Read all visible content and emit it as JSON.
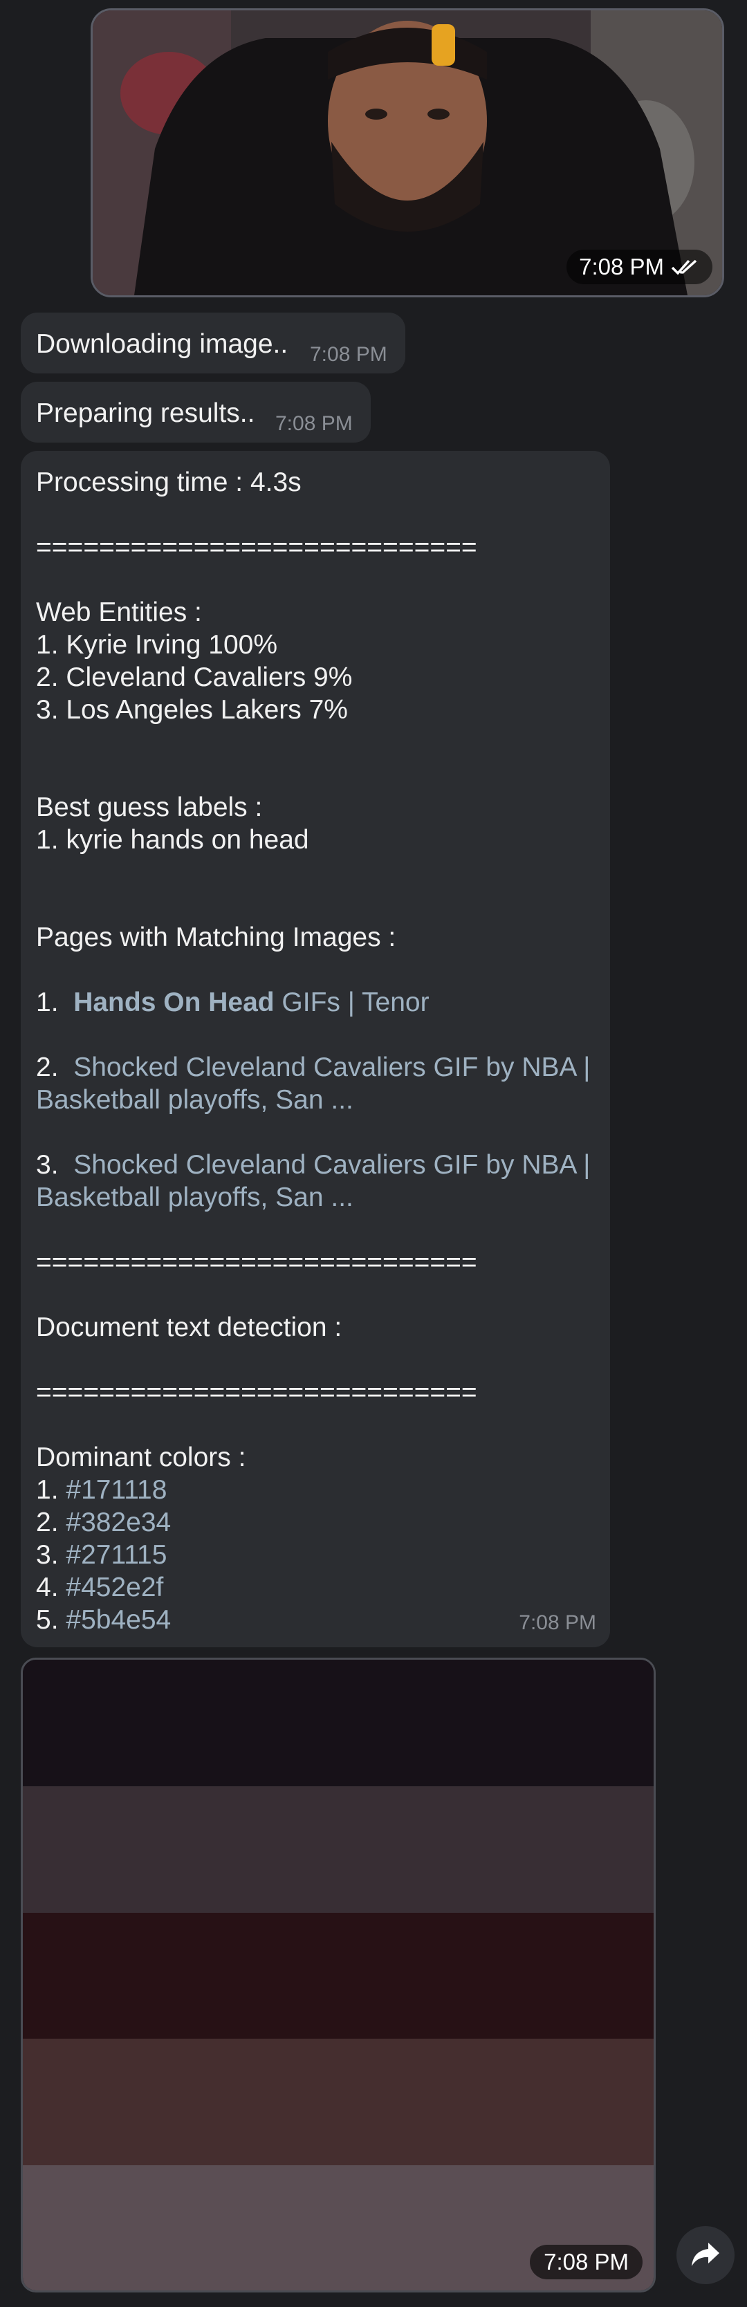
{
  "photo": {
    "time": "7:08 PM"
  },
  "status_messages": [
    {
      "text": "Downloading image..",
      "time": "7:08 PM"
    },
    {
      "text": "Preparing results..",
      "time": "7:08 PM"
    }
  ],
  "result": {
    "processing": "Processing time : 4.3s",
    "separator": "============================",
    "web_entities_title": "Web Entities :",
    "web_entities": [
      "1. Kyrie Irving 100%",
      "2. Cleveland Cavaliers 9%",
      "3. Los Angeles Lakers 7%"
    ],
    "best_guess_title": "Best guess labels :",
    "best_guess": [
      "1. kyrie hands on head"
    ],
    "pages_title": "Pages with Matching Images :",
    "pages": [
      {
        "num": "1.",
        "bold": "Hands On Head",
        "rest": " GIFs | Tenor"
      },
      {
        "num": "2.",
        "line1": "Shocked Cleveland Cavaliers GIF by NBA |",
        "line2": "Basketball playoffs, San ..."
      },
      {
        "num": "3.",
        "line1": "Shocked Cleveland Cavaliers GIF by NBA |",
        "line2": "Basketball playoffs, San ..."
      }
    ],
    "doc_text_title": "Document text detection :",
    "colors_title": "Dominant colors :",
    "colors": [
      {
        "num": "1.",
        "hex": "#171118"
      },
      {
        "num": "2.",
        "hex": "#382e34"
      },
      {
        "num": "3.",
        "hex": "#271115"
      },
      {
        "num": "4.",
        "hex": "#452e2f"
      },
      {
        "num": "5.",
        "hex": "#5b4e54"
      }
    ],
    "time": "7:08 PM"
  },
  "swatch_colors": [
    "#171118",
    "#382e34",
    "#271115",
    "#452e2f",
    "#5b4e54"
  ],
  "swatch_time": "7:08 PM",
  "icons": {
    "read": "double-check-icon",
    "share": "share-icon"
  }
}
